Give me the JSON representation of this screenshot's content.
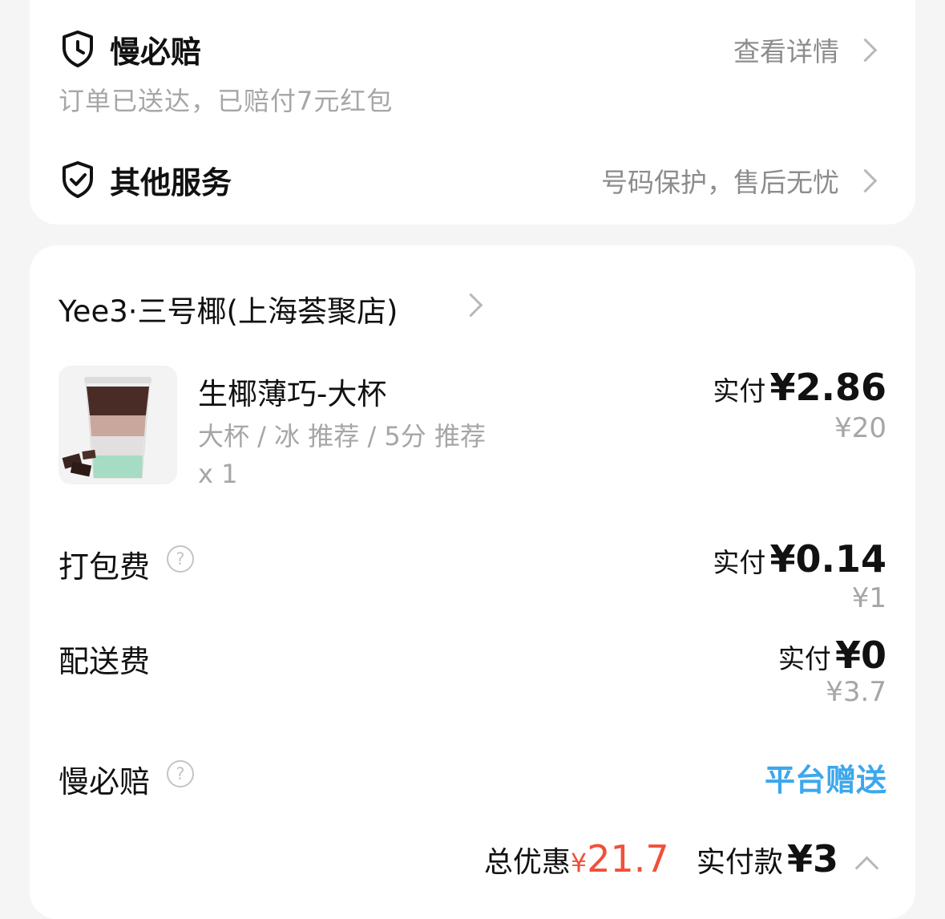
{
  "services": {
    "slow_compensation": {
      "icon": "shield-clock-icon",
      "title": "慢必赔",
      "subtitle": "订单已送达，已赔付7元红包",
      "link_label": "查看详情"
    },
    "other": {
      "icon": "shield-check-icon",
      "title": "其他服务",
      "link_label": "号码保护，售后无忧"
    }
  },
  "order": {
    "shop_name": "Yee3·三号椰(上海荟聚店)",
    "item": {
      "name": "生椰薄巧-大杯",
      "spec": "大杯 / 冰 推荐 / 5分 推荐",
      "qty": "x 1",
      "pay_label": "实付",
      "pay_amount": "¥2.86",
      "original": "¥20"
    },
    "fees": [
      {
        "label": "打包费",
        "pay_label": "实付",
        "pay_amount": "¥0.14",
        "original": "¥1"
      },
      {
        "label": "配送费",
        "pay_label": "实付",
        "pay_amount": "¥0",
        "original": "¥3.7"
      }
    ],
    "slow_comp": {
      "label": "慢必赔",
      "value": "平台赠送"
    },
    "summary": {
      "discount_label": "总优惠",
      "discount_yen": "¥",
      "discount_value": "21.7",
      "total_label": "实付款",
      "total_amount": "¥3"
    }
  },
  "colors": {
    "accent_red": "#f0503a",
    "accent_blue": "#3da7ec"
  }
}
